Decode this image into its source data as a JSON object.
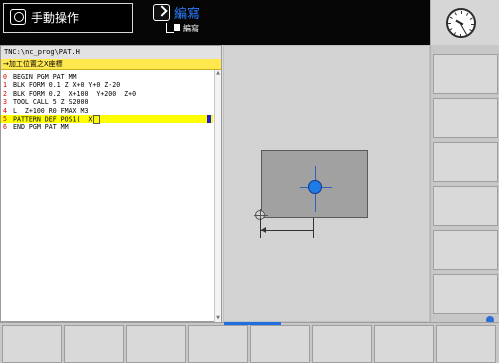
{
  "header": {
    "mode_label": "手動操作",
    "edit_label": "編寫",
    "edit_sub_label": "編寫"
  },
  "program": {
    "path": "TNC:\\nc_prog\\PAT.H",
    "info": "→加工位置之X座標",
    "lines": [
      {
        "no": "0",
        "text": "BEGIN PGM PAT MM"
      },
      {
        "no": "1",
        "text": "BLK FORM 0.1 Z X+0 Y+0 Z-20"
      },
      {
        "no": "2",
        "text": "BLK FORM 0.2  X+100  Y+200  Z+0"
      },
      {
        "no": "3",
        "text": "TOOL CALL 5 Z S2000"
      },
      {
        "no": "4",
        "text": "L  Z+100 R0 FMAX M3"
      },
      {
        "no": "5",
        "text": "PATTERN DEF POS1(  X"
      },
      {
        "no": "6",
        "text": "END PGM PAT MM"
      }
    ]
  },
  "colors": {
    "accent": "#1f6fe0",
    "info_bar": "#ffe84d",
    "active_line": "#ffff00",
    "line_numbers": "#d40000",
    "numbers": "#0050d8"
  }
}
